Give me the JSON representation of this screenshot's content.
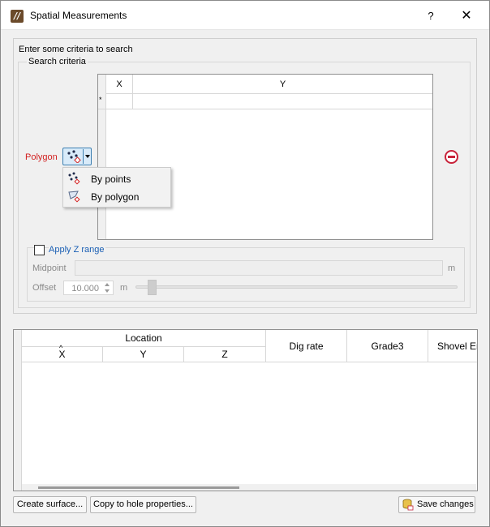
{
  "window": {
    "title": "Spatial Measurements",
    "help_label": "?",
    "close_label": "✕",
    "app_icon_glyph": "//"
  },
  "search": {
    "hint": "Enter some criteria to search",
    "criteria_legend": "Search criteria",
    "coord_grid": {
      "columns": [
        "X",
        "Y"
      ],
      "new_row_marker": "*"
    },
    "polygon_label": "Polygon",
    "polygon_menu": [
      {
        "label": "By points",
        "icon": "points-icon"
      },
      {
        "label": "By polygon",
        "icon": "polygon-icon"
      }
    ],
    "z_range": {
      "label": "Apply Z range",
      "checked": false,
      "midpoint_label": "Midpoint",
      "midpoint_value": "",
      "midpoint_unit": "m",
      "offset_label": "Offset",
      "offset_value": "10.000",
      "offset_unit": "m"
    }
  },
  "results": {
    "group_header": "Location",
    "sub_columns": [
      "X",
      "Y",
      "Z"
    ],
    "columns": [
      "Dig rate",
      "Grade3",
      "Shovel En"
    ],
    "sort_indicator": "^"
  },
  "footer": {
    "create_surface": "Create surface...",
    "copy_to_hole": "Copy to hole properties...",
    "save_changes": "Save changes"
  },
  "colors": {
    "accent_blue": "#1a5fb4",
    "polygon_red": "#d21f1f",
    "remove_red": "#c8223a",
    "button_highlight": "#d9ebf9"
  }
}
